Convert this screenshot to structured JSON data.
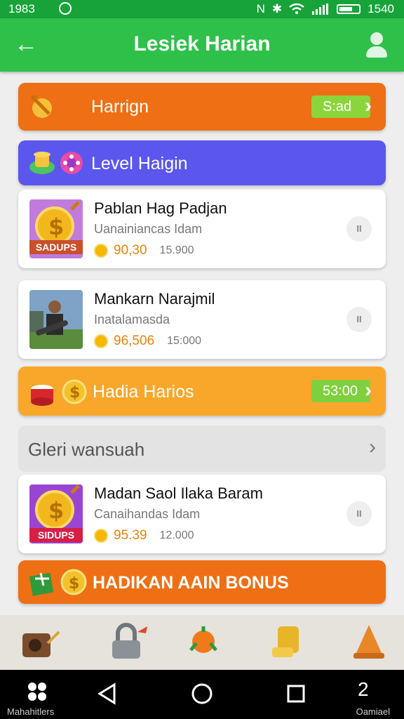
{
  "status": {
    "time": "1983",
    "right_text": "1540"
  },
  "header": {
    "title": "Lesiek Harian"
  },
  "banner1": {
    "label": "Harrign",
    "button": "S:ad"
  },
  "banner2": {
    "label": "Level Haigin"
  },
  "card1": {
    "name": "Pablan Hag Padjan",
    "sub": "Uanainiancas Idam",
    "badge": "SADUPS",
    "price": "90,30",
    "total": "15.900"
  },
  "card2": {
    "name": "Mankarn Narajmil",
    "sub": "Inatalamasda",
    "price": "96,506",
    "total": "15:000"
  },
  "banner3": {
    "label": "Hadia Harios",
    "button": "53:00"
  },
  "section": {
    "label": "Gleri wansuah"
  },
  "card3": {
    "name": "Madan Saol Ilaka Baram",
    "sub": "Canaihandas Idam",
    "badge": "SIDUPS",
    "price": "95.39",
    "total": "12.000"
  },
  "banner4": {
    "label": "HADIKAN AAIN BONUS"
  },
  "navbar": {
    "left_label": "Mahahitlers",
    "right_label": "Oamiael"
  },
  "colors": {
    "green_header": "#2fc04a",
    "orange": "#ee6f14",
    "purple": "#5b56ee",
    "amber": "#f8a72a",
    "pill_green": "#8cd43c",
    "price": "#e8830a"
  },
  "icons": [
    "back-arrow-icon",
    "user-icon",
    "arrow-coin-icon",
    "hat-icon",
    "flower-icon",
    "coin-icon",
    "drum-icon",
    "gift-box-icon",
    "camera-icon",
    "padlock-icon",
    "fruit-icon",
    "cup-icon",
    "cone-icon",
    "nav-back-icon",
    "nav-home-icon",
    "nav-recents-icon"
  ]
}
